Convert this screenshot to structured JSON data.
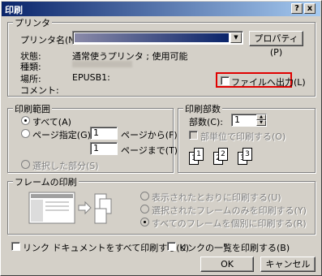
{
  "window": {
    "title": "印刷",
    "help_btn": "?",
    "close_btn": "x"
  },
  "printer": {
    "group_label": "プリンタ",
    "name_label": "プリンタ名(N):",
    "properties_button": "プロパティ(P)",
    "status_label": "状態:",
    "status_value": "通常使うプリンタ ; 使用可能",
    "type_label": "種類:",
    "type_value": "",
    "where_label": "場所:",
    "where_value": "EPUSB1:",
    "comment_label": "コメント:",
    "print_to_file_label": "ファイルへ出力(L)"
  },
  "range": {
    "group_label": "印刷範囲",
    "all_label": "すべて(A)",
    "pages_label": "ページ指定(G)",
    "from_value": "1",
    "from_label": "ページから(F)",
    "to_value": "1",
    "to_label": "ページまで(T)",
    "selection_label": "選択した部分(S)"
  },
  "copies": {
    "group_label": "印刷部数",
    "count_label": "部数(C):",
    "count_value": "1",
    "collate_label": "部単位で印刷する(O)",
    "collate_pages": [
      "1",
      "1",
      "2",
      "2",
      "3",
      "3"
    ]
  },
  "frames": {
    "group_label": "フレームの印刷",
    "opt1_label": "表示されたとおりに印刷する(U)",
    "opt2_label": "選択されたフレームのみを印刷する(Y)",
    "opt3_label": "すべてのフレームを個別に印刷する(R)"
  },
  "bottom": {
    "print_links_label": "リンク ドキュメントをすべて印刷する(K)",
    "print_table_label": "リンクの一覧を印刷する(B)",
    "ok_label": "OK",
    "cancel_label": "キャンセル"
  },
  "colors": {
    "highlight": "#e00000",
    "titlebar": "#0a246a"
  }
}
